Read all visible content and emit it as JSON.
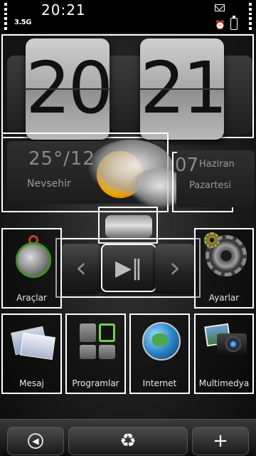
{
  "statusbar": {
    "time": "20:21",
    "network": "3.5G",
    "icons": [
      "signal-icon",
      "mail-icon",
      "alarm-icon",
      "battery-icon"
    ]
  },
  "clock": {
    "hours": "20",
    "minutes": "21"
  },
  "weather": {
    "temperature": "25°/12",
    "city": "Nevsehir",
    "icon": "sun-cloud-icon"
  },
  "date": {
    "day": "07",
    "month": "Haziran",
    "weekday": "Pazartesi"
  },
  "player": {
    "prev_glyph": "‹",
    "play_glyph": "▶‖",
    "next_glyph": "›"
  },
  "apps": {
    "araclar": "Araçlar",
    "ayarlar": "Ayarlar",
    "mesaj": "Mesaj",
    "programlar": "Programlar",
    "internet": "Internet",
    "multimedya": "Multimedya"
  },
  "bottombar": {
    "back_glyph": "◀",
    "middle_glyph": "♻",
    "add_glyph": "+"
  },
  "colors": {
    "tile_border": "#ffffff",
    "accent_green": "#6fd14a"
  }
}
